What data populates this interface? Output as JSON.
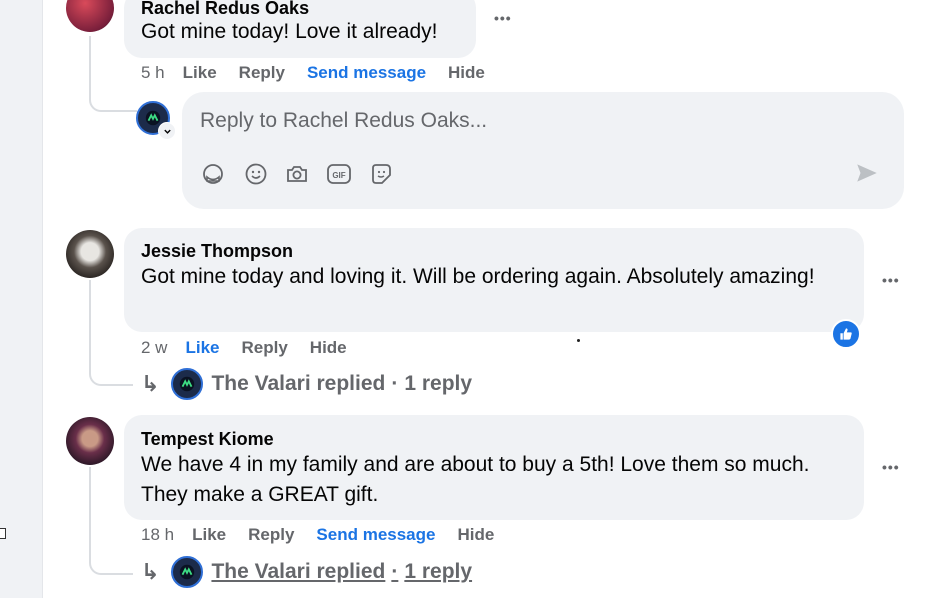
{
  "comments": [
    {
      "author": "Rachel Redus Oaks",
      "text": "Got mine today! Love it already!",
      "time": "5 h",
      "actions": [
        "Like",
        "Reply",
        "Send message",
        "Hide"
      ],
      "more": "•••"
    },
    {
      "author": "Jessie Thompson",
      "text": "Got mine today and loving it. Will be ordering again. Absolutely amazing!",
      "time": "2 w",
      "actions": [
        "Like",
        "Reply",
        "Hide"
      ],
      "more": "•••",
      "replies": {
        "name": "The Valari replied",
        "sep": "·",
        "count": "1 reply"
      }
    },
    {
      "author": "Tempest Kiome",
      "text": "We have 4 in my family and are about to buy a 5th! Love them so much. They make a GREAT gift.",
      "time": "18 h",
      "actions": [
        "Like",
        "Reply",
        "Send message",
        "Hide"
      ],
      "more": "•••",
      "replies": {
        "name": "The Valari replied",
        "sep": "·",
        "count": "1 reply"
      }
    }
  ],
  "reply_box": {
    "placeholder": "Reply to Rachel Redus Oaks...",
    "tools": [
      "avatar-sticker-icon",
      "emoji-icon",
      "camera-icon",
      "gif-icon",
      "sticker-icon"
    ],
    "gif_label": "GIF"
  },
  "colors": {
    "accent": "#1b74e4",
    "bubble": "#f0f2f5",
    "muted": "#65676b"
  }
}
